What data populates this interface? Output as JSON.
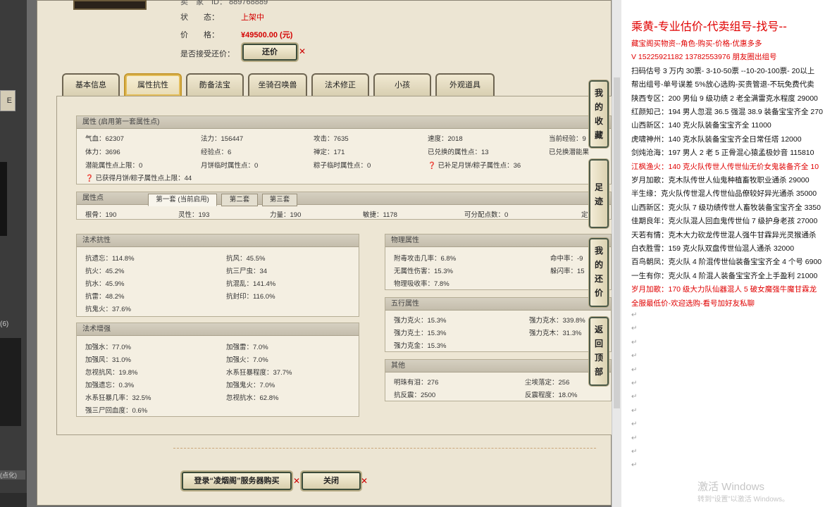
{
  "item": {
    "status_label": "状",
    "status_label2": "态：",
    "status_value": "上架中",
    "price_label": "价",
    "price_label2": "格：",
    "price_value": "¥49500.00 (元)",
    "accept_counter_label": "是否接受还价：",
    "counter_button": "还价",
    "top_partial": "卖　家　ID：  889768889"
  },
  "tabs": [
    "基本信息",
    "属性抗性",
    "防备法宝",
    "坐骑召唤兽",
    "法术修正",
    "小孩",
    "外观道具"
  ],
  "active_tab": 1,
  "attributes": {
    "header": "属性 (启用第一套属性点)",
    "rows": [
      [
        "气血：62307",
        "法力：156447",
        "攻击：7635",
        "速度：2018",
        "当前经验：9"
      ],
      [
        "体力：3696",
        "经验点：6",
        "禅定：171",
        "已兑换的属性点：13",
        "已兑换潜能果"
      ],
      [
        "潜能属性点上限：0",
        "月饼临时属性点：0",
        "粽子临时属性点：0",
        "已补足月饼/粽子属性点：36",
        ""
      ]
    ],
    "note": "已获得月饼/粽子属性点上限：44"
  },
  "points": {
    "header": "属性点",
    "subtabs": [
      "第一套 (当前启用)",
      "第二套",
      "第三套"
    ],
    "values": [
      "根骨：190",
      "灵性：193",
      "力量：190",
      "敏捷：1178",
      "可分配点数：0",
      "定"
    ]
  },
  "fashu_kangxing": {
    "header": "法术抗性",
    "left": [
      "抗遗忘：114.8%",
      "抗火：45.2%",
      "抗水：45.9%",
      "抗雷：48.2%",
      "抗鬼火：37.6%"
    ],
    "right": [
      "抗风：45.5%",
      "抗三尸虫：34",
      "抗混乱：141.4%",
      "抗封印：116.0%"
    ]
  },
  "fashu_zengqiang": {
    "header": "法术增强",
    "left": [
      "加强水：77.0%",
      "加强风：31.0%",
      "忽视抗风：19.8%",
      "加强遗忘：0.3%",
      "水系狂暴几率：32.5%",
      "强三尸回血度：0.6%"
    ],
    "right": [
      "加强雷：7.0%",
      "加强火：7.0%",
      "水系狂暴程度：37.7%",
      "加强鬼火：7.0%",
      "忽视抗水：62.8%"
    ]
  },
  "wuli": {
    "header": "物理属性",
    "left": [
      "附毒攻击几率：6.8%",
      "无属性伤害：15.3%",
      "物理吸收率：7.8%"
    ],
    "right": [
      "命中率：-9",
      "躲闪率：15"
    ]
  },
  "wuxing": {
    "header": "五行属性",
    "left": [
      "强力克火：15.3%",
      "强力克土：15.3%",
      "强力克金：15.3%"
    ],
    "right": [
      "强力克水：339.8%",
      "强力克木：31.3%"
    ]
  },
  "qita": {
    "header": "其他",
    "left": [
      "明珠有泪：276",
      "抗反震：2500"
    ],
    "right": [
      "尘埃落定：256",
      "反震程度：18.0%"
    ]
  },
  "side_buttons": [
    "我的收藏",
    "足迹",
    "我的还价",
    "返回顶部"
  ],
  "bottom_buttons": {
    "buy": "登录“凌烟阁”服务器购买",
    "close": "关闭"
  },
  "doc": {
    "title": "乘黄-专业估价-代卖组号-找号--",
    "lines": [
      {
        "t": "藏宝阁买物资--角色-购买-价格-优惠多多",
        "red": true
      },
      {
        "t": "V 15225921182    13782553976 朋友圈出组号",
        "red": true
      },
      {
        "t": "扫码估号 3 万内 30票- 3-10-50票  --10-20-100票- 20以上",
        "red": false
      },
      {
        "t": "帮出组号-单号误差 5%放心选购-买贵管退-不玩免费代卖",
        "red": false
      },
      {
        "t": "陕西专区：200 男仙 9 级功绩 2 老全满雷克水程度 29000",
        "red": false
      },
      {
        "t": "红颜知己：194 男人忽混 36.5 强混 38.9 装备宝宝齐全 270",
        "red": false
      },
      {
        "t": "山西新区：140 克火队装备宝宝齐全 11000",
        "red": false
      },
      {
        "t": "虎啸神州：140 克水队装备宝宝齐全日常任塔 12000",
        "red": false
      },
      {
        "t": "剑炖沧海：197 男人 2 老 5 正骨混心猿孟极妙音 115810",
        "red": false
      },
      {
        "t": "江枫渔火：140 克火队传世人传世仙无价女鬼装备齐全 10",
        "red": true
      },
      {
        "t": "岁月加歌：克木队传世人仙鬼种植畜牧职业通杀 29000",
        "red": false
      },
      {
        "t": "半生缘：克火队传世混人传世仙品僚较好异光通杀 35000",
        "red": false
      },
      {
        "t": "山西新区：克火队 7 级功绩传世人畜牧装备宝宝齐全 3350",
        "red": false
      },
      {
        "t": "佳期良年：克火队混人回血鬼传世仙 7 级护身老孩 27000",
        "red": false
      },
      {
        "t": "天若有情：克木大力砍龙传世混人强牛甘霖异光灵猴通杀",
        "red": false
      },
      {
        "t": "白衣胜雪：159 克火队双盘传世仙混人通杀 32000",
        "red": false
      },
      {
        "t": "百鸟朝凤：克火队 4 阶混传世仙装备宝宝齐全 4 个号 6900",
        "red": false
      },
      {
        "t": "一生有你：克火队 4 阶混人装备宝宝齐全上手盈利 21000",
        "red": false
      },
      {
        "t": "岁月加歌：170 级大力队仙器混人 5 破女魔强牛魔甘霖龙",
        "red": true
      },
      {
        "t": "全服最低价-欢迎选购-看号加好友私聊",
        "red": true
      }
    ],
    "watermark_1": "激活 Windows",
    "watermark_2": "转到“设置”以激活 Windows。"
  },
  "left_strip": {
    "tab": "E",
    "count": "(6)",
    "bottom": "(点化)"
  }
}
